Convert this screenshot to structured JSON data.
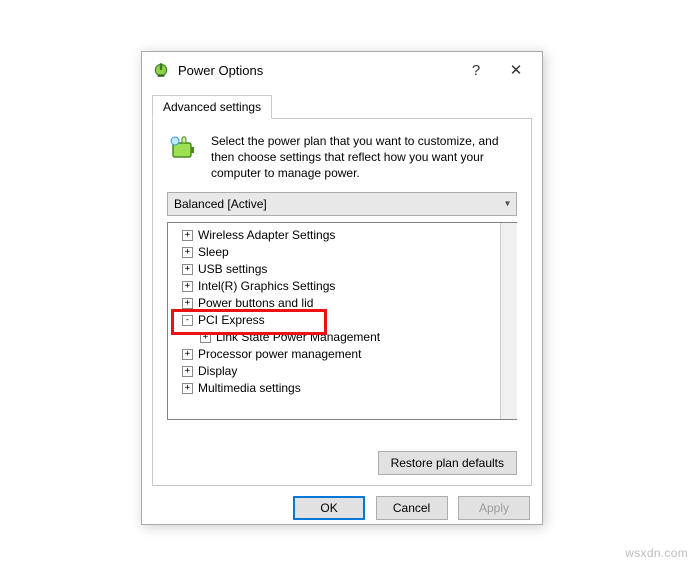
{
  "titlebar": {
    "title": "Power Options"
  },
  "tab": {
    "label": "Advanced settings"
  },
  "intro": {
    "text": "Select the power plan that you want to customize, and then choose settings that reflect how you want your computer to manage power."
  },
  "plan": {
    "selected": "Balanced [Active]"
  },
  "tree": {
    "items": [
      {
        "label": "Wireless Adapter Settings",
        "indent": 1,
        "exp": "+"
      },
      {
        "label": "Sleep",
        "indent": 1,
        "exp": "+"
      },
      {
        "label": "USB settings",
        "indent": 1,
        "exp": "+"
      },
      {
        "label": "Intel(R) Graphics Settings",
        "indent": 1,
        "exp": "+"
      },
      {
        "label": "Power buttons and lid",
        "indent": 1,
        "exp": "+"
      },
      {
        "label": "PCI Express",
        "indent": 1,
        "exp": "-"
      },
      {
        "label": "Link State Power Management",
        "indent": 2,
        "exp": "+"
      },
      {
        "label": "Processor power management",
        "indent": 1,
        "exp": "+"
      },
      {
        "label": "Display",
        "indent": 1,
        "exp": "+"
      },
      {
        "label": "Multimedia settings",
        "indent": 1,
        "exp": "+"
      }
    ]
  },
  "buttons": {
    "restore": "Restore plan defaults",
    "ok": "OK",
    "cancel": "Cancel",
    "apply": "Apply"
  },
  "watermark": "wsxdn.com"
}
